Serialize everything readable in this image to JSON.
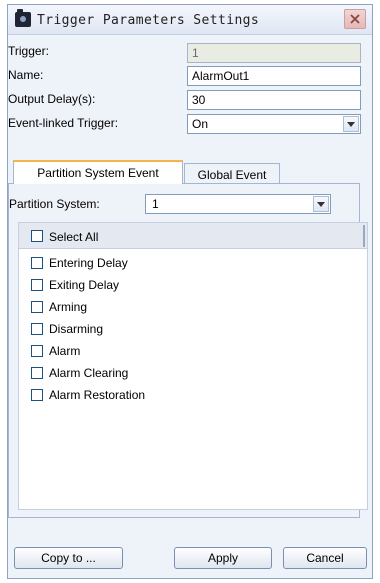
{
  "window": {
    "title": "Trigger Parameters Settings"
  },
  "form": {
    "trigger_label": "Trigger:",
    "trigger_value": "1",
    "name_label": "Name:",
    "name_value": "AlarmOut1",
    "delay_label": "Output Delay(s):",
    "delay_value": "30",
    "linked_label": "Event-linked Trigger:",
    "linked_value": "On"
  },
  "tabs": [
    {
      "label": "Partition System Event",
      "active": true
    },
    {
      "label": "Global Event",
      "active": false
    }
  ],
  "partition": {
    "label": "Partition System:",
    "value": "1"
  },
  "list": {
    "select_all": "Select All",
    "items": [
      "Entering Delay",
      "Exiting Delay",
      "Arming",
      "Disarming",
      "Alarm",
      "Alarm Clearing",
      "Alarm Restoration"
    ]
  },
  "buttons": {
    "copy": "Copy to ...",
    "apply": "Apply",
    "cancel": "Cancel"
  },
  "colors": {
    "accent_tab": "#f4b64a",
    "dialog_bg": "#eef2f9",
    "border": "#8ea3c6",
    "close_bg": "#e8b7b7"
  },
  "icons": {
    "app": "camera-icon",
    "close": "close-icon",
    "dropdown": "chevron-down-icon"
  }
}
